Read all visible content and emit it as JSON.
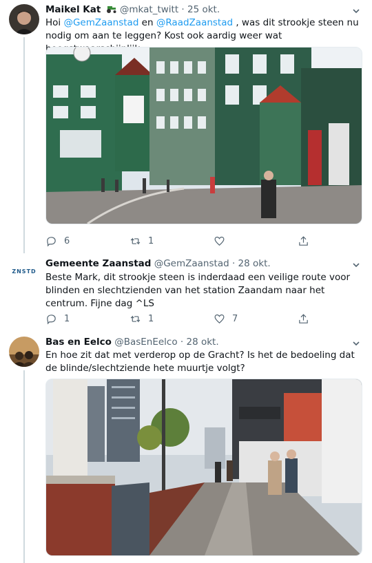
{
  "tweets": [
    {
      "name": "Maikel Kat",
      "badge": "tractor-emoji",
      "handle": "@mkat_twitt",
      "dot": "·",
      "date": "25 okt.",
      "text_parts": [
        "Hoi ",
        "@GemZaanstad",
        " en ",
        "@RaadZaanstad",
        " , was dit strookje steen nu nodig om aan te leggen? Kost ook aardig weer wat hoogstwaarschijnlijk."
      ],
      "replies": "6",
      "retweets": "1",
      "likes": ""
    },
    {
      "name": "Gemeente Zaanstad",
      "handle": "@GemZaanstad",
      "dot": "·",
      "date": "28 okt.",
      "avatar_text": "ZNSTD",
      "text": "Beste Mark, dit strookje steen is inderdaad een veilige route voor blinden en slechtzienden van het station Zaandam naar het centrum. Fijne dag ^LS",
      "replies": "1",
      "retweets": "1",
      "likes": "7"
    },
    {
      "name": "Bas en Eelco",
      "handle": "@BasEnEelco",
      "dot": "·",
      "date": "28 okt.",
      "text": "En hoe zit dat met verderop op de Gracht? Is het de bedoeling dat de blinde/slechtziende hete muurtje volgt?"
    }
  ],
  "colors": {
    "link": "#1d9bf0",
    "muted": "#536471",
    "thread": "#cfd9de"
  },
  "icons": [
    "reply-icon",
    "retweet-icon",
    "like-icon",
    "share-icon",
    "chevron-down-icon"
  ]
}
